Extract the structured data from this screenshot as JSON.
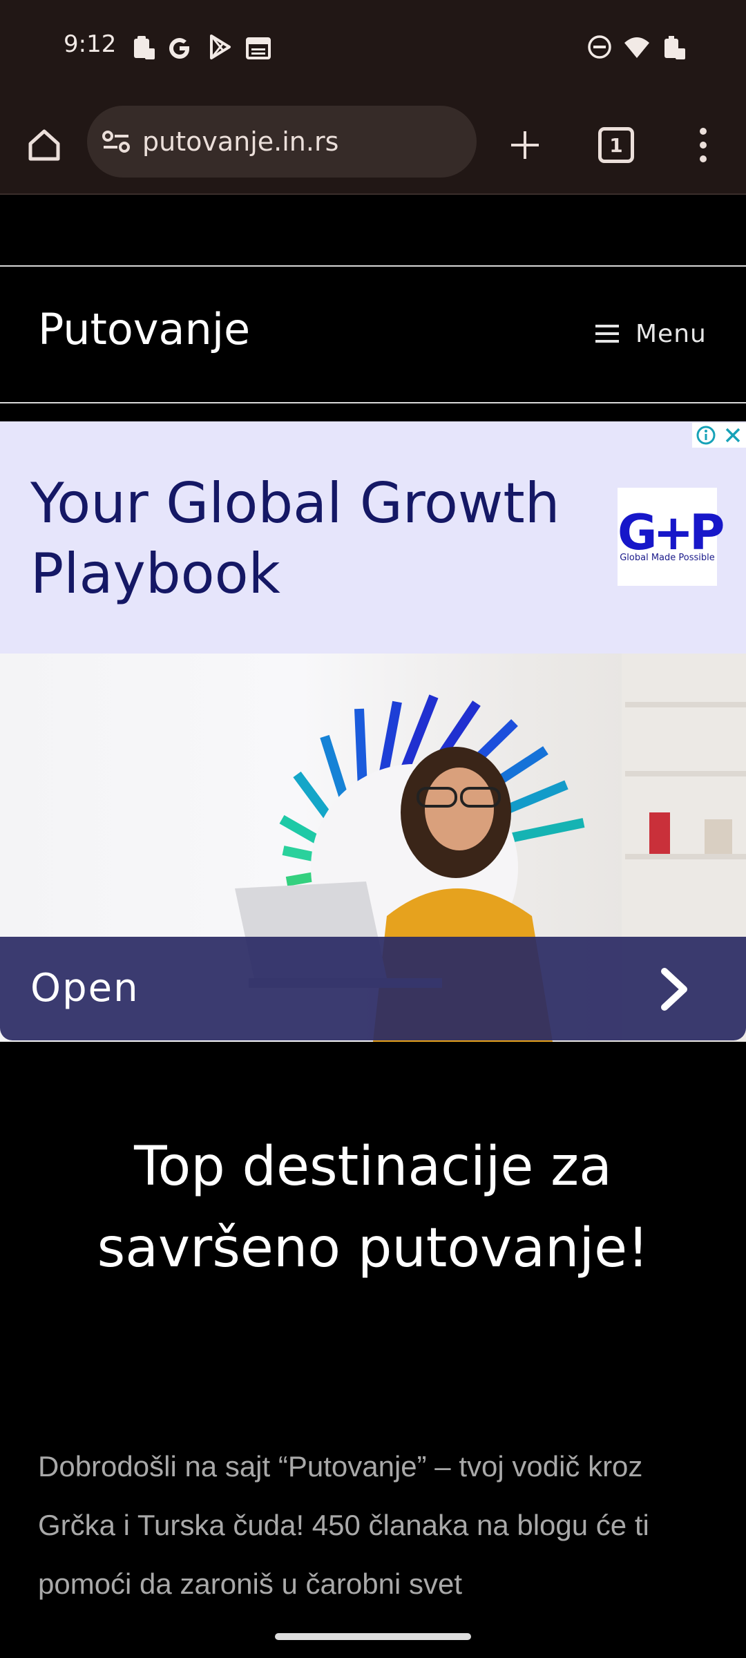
{
  "status_bar": {
    "time": "9:12",
    "left_icons": [
      "clipboard-icon",
      "google-icon",
      "play-store-icon",
      "calendar-icon"
    ],
    "right_icons": [
      "do-not-disturb-icon",
      "wifi-icon",
      "battery-icon"
    ]
  },
  "browser": {
    "url": "putovanje.in.rs",
    "tab_count": "1",
    "icons": [
      "home-icon",
      "site-settings-icon",
      "new-tab-icon",
      "tab-switcher-icon",
      "more-options-icon"
    ]
  },
  "site": {
    "title": "Putovanje",
    "menu_label": "Menu"
  },
  "ad": {
    "headline": "Your Global Growth Playbook",
    "logo_text": "G+P",
    "logo_tagline": "Global Made Possible",
    "cta_label": "Open",
    "colors": {
      "background": "#e6e5fb",
      "headline": "#151865",
      "cta_bar": "#2a2a64",
      "logo": "#1717c9"
    }
  },
  "content": {
    "headline": "Top destinacije za savršeno putovanje!",
    "intro": "Dobrodošli na sajt “Putovanje” – tvoj vodič kroz Grčka i Turska čuda! 450 članaka na blogu će ti pomoći da zaroniš u čarobni svet"
  }
}
